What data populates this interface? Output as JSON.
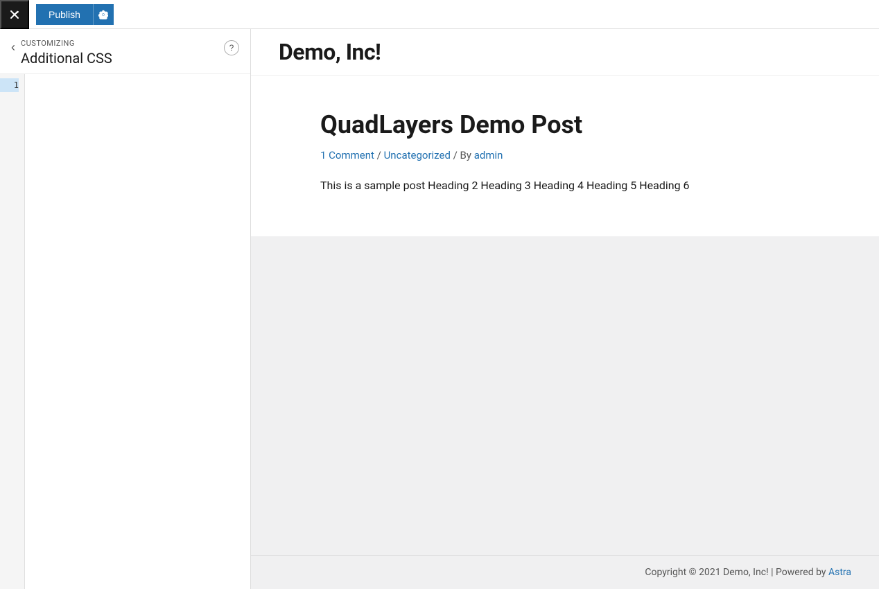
{
  "topbar": {
    "publish_label": "Publish",
    "close_icon": "×"
  },
  "sidebar": {
    "customizing_label": "Customizing",
    "section_title": "Additional CSS",
    "help_label": "?",
    "back_label": "‹",
    "line_numbers": [
      1
    ],
    "active_line": 1
  },
  "preview": {
    "site_title": "Demo, Inc!",
    "post": {
      "title": "QuadLayers Demo Post",
      "meta_comment": "1 Comment",
      "meta_sep1": " / ",
      "meta_category": "Uncategorized",
      "meta_sep2": " / By ",
      "meta_author": "admin",
      "excerpt": "This is a sample post Heading 2 Heading 3 Heading 4 Heading 5 Heading 6"
    },
    "footer": {
      "text": "Copyright © 2021 Demo, Inc! | Powered by ",
      "brand": "Astra"
    }
  }
}
